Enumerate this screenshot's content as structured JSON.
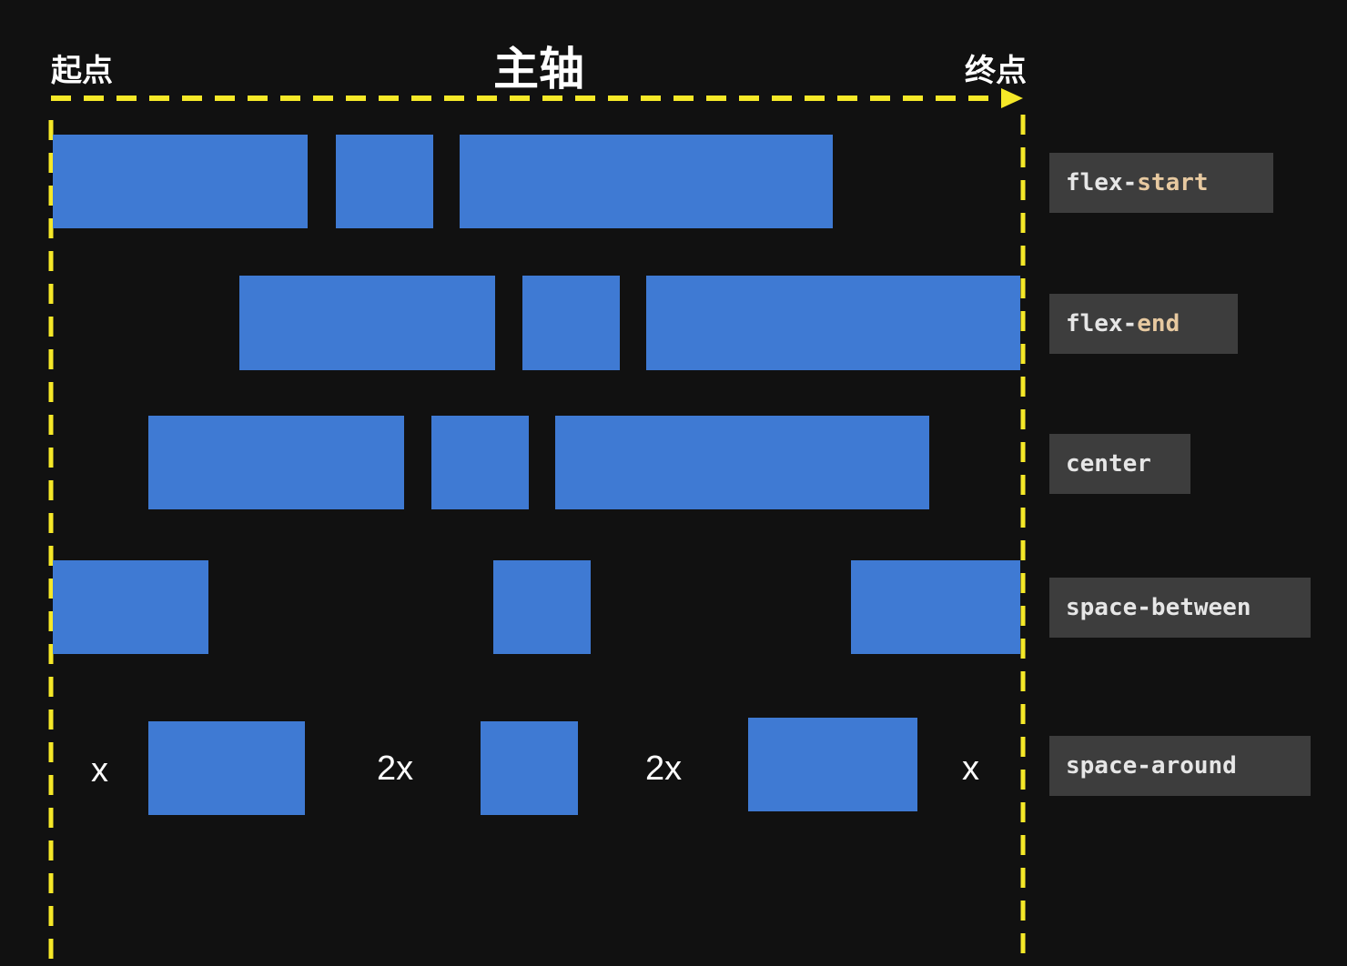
{
  "labels": {
    "start": "起点",
    "main_axis": "主轴",
    "end": "终点"
  },
  "colors": {
    "background": "#111111",
    "box": "#3f7ad3",
    "axis": "#f5e828",
    "tag_bg": "#3d3d3d"
  },
  "rows": [
    {
      "tag_prefix": "flex-",
      "tag_suffix": "start"
    },
    {
      "tag_prefix": "flex-",
      "tag_suffix": "end"
    },
    {
      "tag_prefix": "",
      "tag_suffix": "center"
    },
    {
      "tag_prefix": "",
      "tag_suffix": "space-between"
    },
    {
      "tag_prefix": "",
      "tag_suffix": "space-around"
    }
  ],
  "space_around_gaps": [
    "x",
    "2x",
    "2x",
    "x"
  ]
}
